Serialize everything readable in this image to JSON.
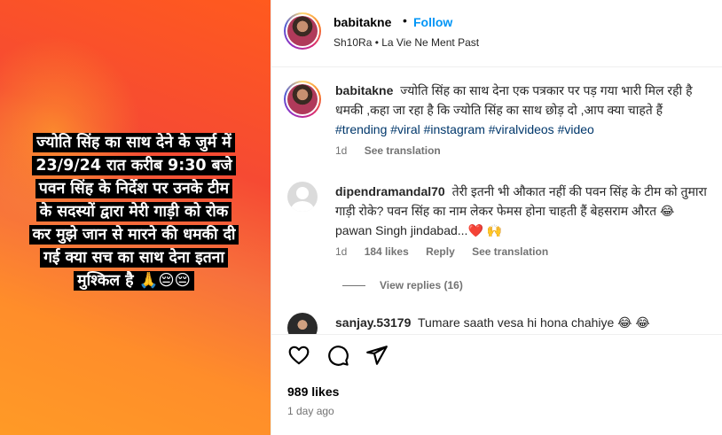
{
  "post": {
    "overlay_lines": [
      "ज्योति सिंह का साथ देने के जुर्म में",
      "23/9/24 रात करीब 9:30 बजे",
      "पवन सिंह के निर्देश पर उनके टीम",
      "के सदस्यों द्वारा मेरी गाड़ी को रोक",
      "कर मुझे जान से मारने की धमकी दी",
      "गई क्या सच का साथ देना इतना",
      "मुश्किल है 🙏😔😔"
    ]
  },
  "header": {
    "username": "babitakne",
    "separator": "•",
    "follow_label": "Follow",
    "subtitle": "Sh10Ra • La Vie Ne Ment Past"
  },
  "caption": {
    "username": "babitakne",
    "text": "ज्योति सिंह का साथ देना एक पत्रकार पर पड़ गया भारी मिल रही है धमकी ,कहा जा रहा है कि ज्योति सिंह का साथ छोड़ दो ,आप क्या चाहते हैं",
    "hashtags": "#trending #viral #instagram #viralvideos #video",
    "age": "1d",
    "see_translation": "See translation"
  },
  "comments": [
    {
      "username": "dipendramandal70",
      "text": "तेरी इतनी भी औकात नहीं की पवन सिंह के टीम को तुमारा गाड़ी रोके? पवन सिंह का नाम लेकर फेमस होना चाहती हैं बेहसराम औरत 😂 pawan Singh jindabad...❤️ 🙌",
      "age": "1d",
      "likes": "184 likes",
      "reply": "Reply",
      "see_translation": "See translation",
      "view_replies": "View replies (16)"
    },
    {
      "username": "sanjay.53179",
      "text": "Tumare saath vesa hi hona chahiye 😂 😂"
    }
  ],
  "footer": {
    "likes": "989 likes",
    "time": "1 day ago"
  },
  "icons": {
    "like": "heart-icon",
    "comment": "comment-icon",
    "share": "share-icon"
  }
}
